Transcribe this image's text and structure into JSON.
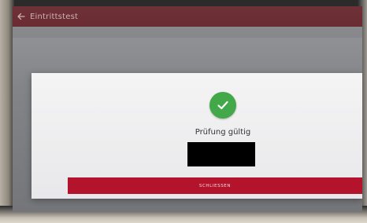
{
  "app_bar": {
    "title": "Eintrittstest",
    "back_icon": "arrow-left-icon"
  },
  "dialog": {
    "status_icon": "check-circle-icon",
    "status_text": "Prüfung gültig",
    "close_label": "SCHLIESSEN"
  },
  "colors": {
    "app_bar": "#5e1a22",
    "success": "#43a84a",
    "close_button": "#b3142b"
  }
}
